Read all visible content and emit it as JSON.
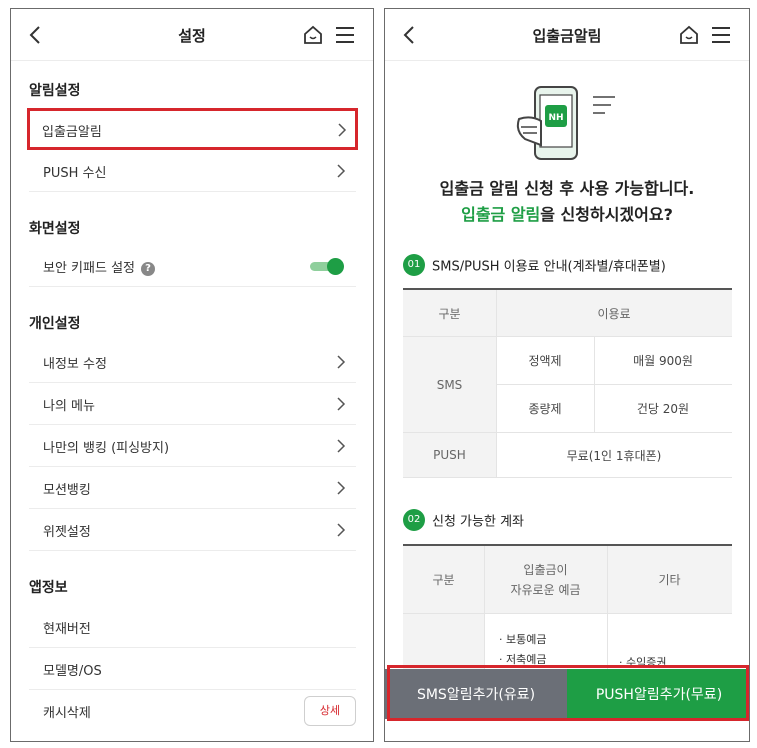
{
  "left": {
    "header": {
      "title": "설정"
    },
    "sections": {
      "alarm": "알림설정",
      "screen": "화면설정",
      "personal": "개인설정",
      "appinfo": "앱정보"
    },
    "items": {
      "deposit_alarm": "입출금알림",
      "push": "PUSH 수신",
      "secure_keypad": "보안 키패드 설정",
      "my_info": "내정보 수정",
      "my_menu": "나의 메뉴",
      "my_banking": "나만의 뱅킹 (피싱방지)",
      "motion_banking": "모션뱅킹",
      "widget": "위젯설정",
      "current_version": "현재버전",
      "model_os": "모델명/OS",
      "cache_delete": "캐시삭제"
    },
    "help_icon_glyph": "?",
    "detail_button": "상세",
    "toggle_on": true
  },
  "right": {
    "header": {
      "title": "입출금알림"
    },
    "illustration_badge": "NH",
    "headline_line1": "입출금 알림 신청 후 사용 가능합니다.",
    "headline_line2_green": "입출금 알림",
    "headline_line2_rest": "을 신청하시겠어요?",
    "section1": {
      "num": "01",
      "title": "SMS/PUSH 이용료 안내(계좌별/휴대폰별)"
    },
    "fee_table": {
      "h_category": "구분",
      "h_fee": "이용료",
      "sms": "SMS",
      "flat": "정액제",
      "flat_fee": "매월 900원",
      "metered": "종량제",
      "metered_fee": "건당 20원",
      "push": "PUSH",
      "push_fee": "무료(1인 1휴대폰)"
    },
    "section2": {
      "num": "02",
      "title": "신청 가능한 계좌"
    },
    "acct_table": {
      "h_category": "구분",
      "h_deposit_1": "입출금이",
      "h_deposit_2": "자유로운 예금",
      "h_other": "기타",
      "dep_1": "· 보통예금",
      "dep_2": "· 저축예금",
      "other_1": "· 수익증권"
    },
    "buttons": {
      "sms": "SMS알림추가(유료)",
      "push": "PUSH알림추가(무료)"
    }
  },
  "colors": {
    "brand_green": "#1e9e45",
    "highlight_red": "#d6262c",
    "sms_button_gray": "#6b6f77"
  }
}
